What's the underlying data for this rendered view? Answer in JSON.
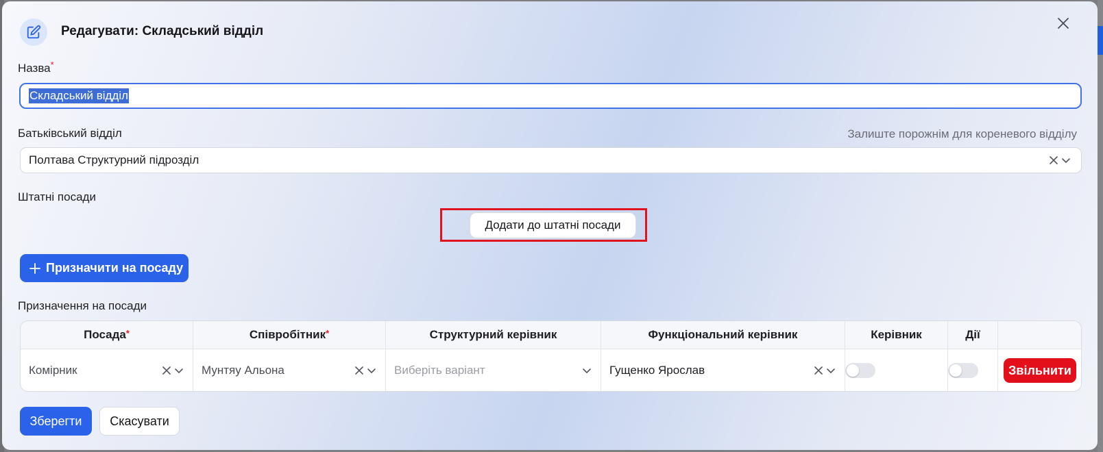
{
  "dialog": {
    "title": "Редагувати: Складський відділ"
  },
  "form": {
    "name_label": "Назва",
    "name_value": "Складський відділ",
    "parent_label": "Батьківський відділ",
    "parent_hint": "Залиште порожнім для кореневого відділу",
    "parent_value": "Полтава Структурний підрозділ",
    "staff_label": "Штатні посади",
    "add_staff_button": "Додати до штатні посади",
    "assign_button": "Призначити на посаду",
    "assignments_label": "Призначення на посади"
  },
  "table": {
    "headers": {
      "position": "Посада",
      "employee": "Співробітник",
      "structural_manager": "Структурний керівник",
      "functional_manager": "Функціональний керівник",
      "manager": "Керівник",
      "actions": "Дії"
    },
    "row": {
      "position": "Комірник",
      "employee": "Мунтяу Альона",
      "structural_manager_placeholder": "Виберіть варіант",
      "functional_manager": "Гущенко Ярослав",
      "manager_on": false,
      "actions_on": false,
      "dismiss_button": "Звільнити"
    }
  },
  "footer": {
    "save_button": "Зберегти",
    "cancel_button": "Скасувати"
  },
  "colors": {
    "primary": "#2a63ea",
    "danger": "#e3101c",
    "highlight_frame": "#e0141e"
  },
  "icons": {
    "header": "pencil-square-icon",
    "close": "close-icon",
    "clear": "clear-x-icon",
    "dropdown": "chevron-down-icon",
    "add": "plus-icon"
  }
}
